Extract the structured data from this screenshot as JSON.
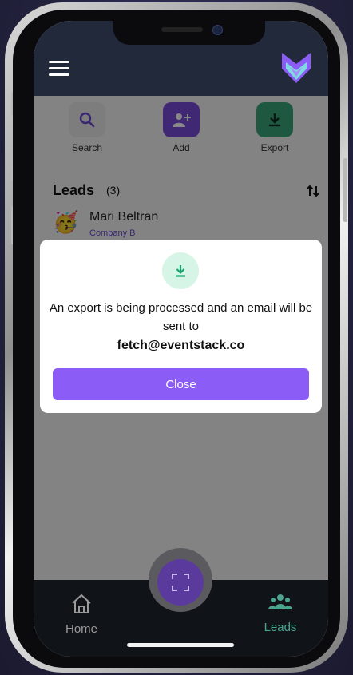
{
  "header": {
    "menu_icon": "hamburger-menu-icon",
    "logo_icon": "fox-logo-icon"
  },
  "actions": {
    "search": {
      "label": "Search",
      "icon": "search-icon"
    },
    "add": {
      "label": "Add",
      "icon": "add-user-icon"
    },
    "export": {
      "label": "Export",
      "icon": "download-icon"
    }
  },
  "leads": {
    "title": "Leads",
    "count": "(3)",
    "sort_icon": "sort-arrows-icon",
    "items": [
      {
        "name": "Mari Beltran",
        "company": "Company B",
        "avatar": "🥳"
      }
    ]
  },
  "modal": {
    "icon": "download-icon",
    "message": "An export is being processed and an email will be sent to",
    "email": "fetch@eventstack.co",
    "close_label": "Close"
  },
  "bottom_nav": {
    "home_label": "Home",
    "leads_label": "Leads",
    "scan_icon": "scan-frame-icon"
  },
  "colors": {
    "accent": "#8b5cf6",
    "header_bg": "#22293a",
    "export_green": "#3aa77c",
    "leads_active": "#4aa58f"
  }
}
